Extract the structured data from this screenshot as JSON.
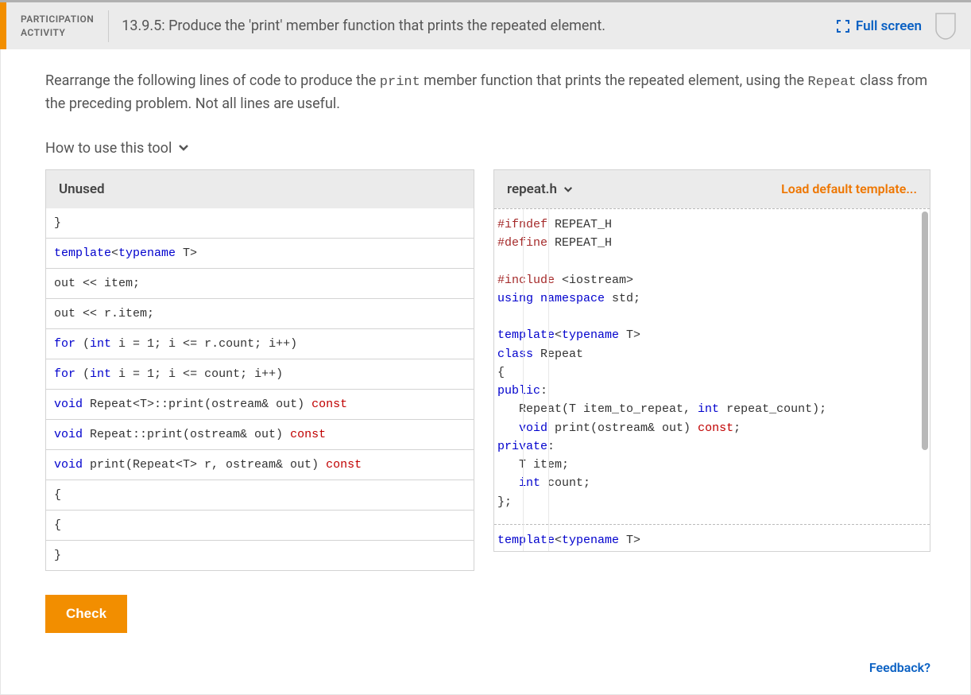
{
  "header": {
    "activity_type_line1": "PARTICIPATION",
    "activity_type_line2": "ACTIVITY",
    "title": "13.9.5: Produce the 'print' member function that prints the repeated element.",
    "fullscreen_label": "Full screen"
  },
  "instructions": {
    "text_pre": "Rearrange the following lines of code to produce the ",
    "code1": "print",
    "text_mid": " member function that prints the repeated element, using the ",
    "code2": "Repeat",
    "text_post": " class from the preceding problem. Not all lines are useful."
  },
  "how_to_use": "How to use this tool",
  "unused": {
    "header": "Unused",
    "blocks": [
      {
        "html": "}"
      },
      {
        "html": "<span class='kw'>template</span>&lt;<span class='kw'>typename</span> T&gt;"
      },
      {
        "html": "out &lt;&lt; item;"
      },
      {
        "html": "out &lt;&lt; r.item;"
      },
      {
        "html": "<span class='kw'>for</span> (<span class='kw'>int</span> i = 1; i &lt;= r.count; i++)"
      },
      {
        "html": "<span class='kw'>for</span> (<span class='kw'>int</span> i = 1; i &lt;= count; i++)"
      },
      {
        "html": "<span class='kw'>void</span> Repeat&lt;T&gt;::<span class='id'>print</span>(ostream&amp; out) <span class='kwred'>const</span>"
      },
      {
        "html": "<span class='kw'>void</span> Repeat::print(ostream&amp; out) <span class='kwred'>const</span>"
      },
      {
        "html": "<span class='kw'>void</span> print(Repeat&lt;T&gt; r, ostream&amp; out) <span class='kwred'>const</span>"
      },
      {
        "html": "{"
      },
      {
        "html": "{"
      },
      {
        "html": "}"
      }
    ]
  },
  "editor": {
    "filename": "repeat.h",
    "load_template": "Load default template...",
    "code_lines": [
      "<span class='pre'>#ifndef</span> REPEAT_H",
      "<span class='pre'>#define</span> REPEAT_H",
      "",
      "<span class='pre'>#include</span> &lt;iostream&gt;",
      "<span class='kw'>using</span> <span class='kw'>namespace</span> std;",
      "",
      "<span class='kw'>template</span>&lt;<span class='kw'>typename</span> T&gt;",
      "<span class='kw'>class</span> Repeat",
      "{",
      "<span class='kw'>public</span>:",
      "   Repeat(T item_to_repeat, <span class='kw'>int</span> repeat_count);",
      "   <span class='kw'>void</span> print(ostream&amp; out) <span class='kwred'>const</span>;",
      "<span class='kw'>private</span>:",
      "   T item;",
      "   <span class='kw'>int</span> count;",
      "};"
    ],
    "code_lines_bottom": [
      "<span class='kw'>template</span>&lt;<span class='kw'>typename</span> T&gt;"
    ]
  },
  "check_label": "Check",
  "feedback_label": "Feedback?"
}
